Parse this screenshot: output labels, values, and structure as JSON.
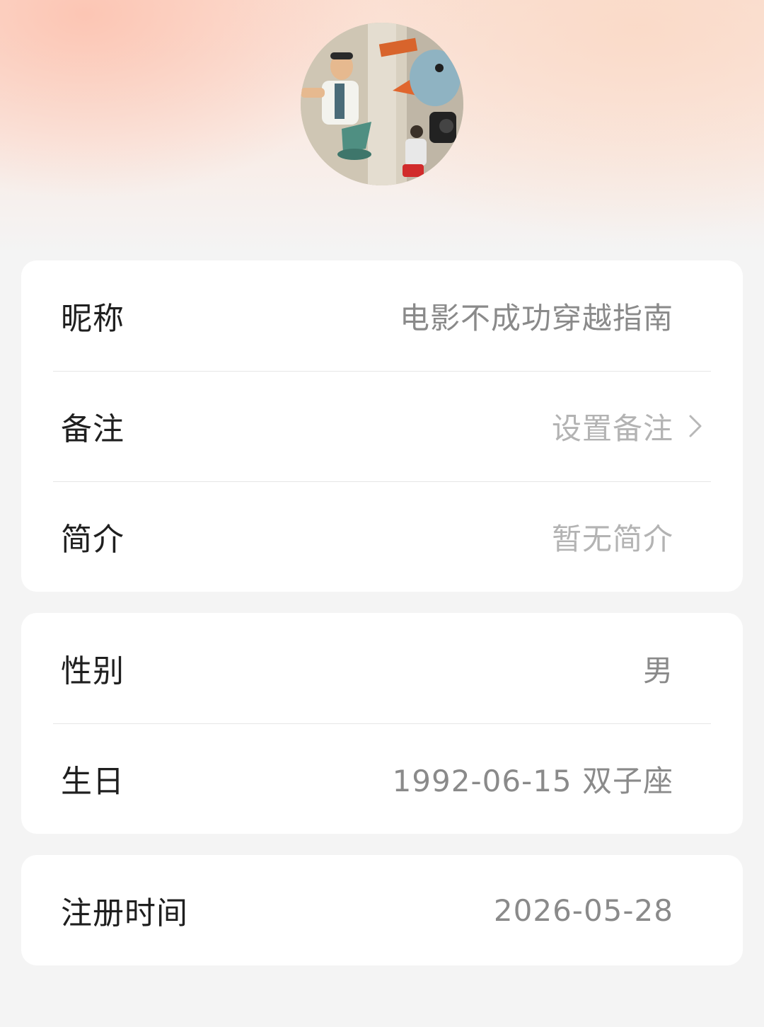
{
  "profile": {
    "avatar_icon": "user-avatar-image"
  },
  "basic_info": {
    "nickname_label": "昵称",
    "nickname_value": "电影不成功穿越指南",
    "remark_label": "备注",
    "remark_value": "设置备注",
    "bio_label": "简介",
    "bio_value": "暂无简介"
  },
  "personal_info": {
    "gender_label": "性别",
    "gender_value": "男",
    "birthday_label": "生日",
    "birthday_value": "1992-06-15 双子座"
  },
  "account_info": {
    "register_label": "注册时间",
    "register_value": "2026-05-28"
  },
  "icons": {
    "chevron": "chevron-right-icon"
  },
  "colors": {
    "header_gradient": "#fbe3d8",
    "page_background": "#f4f4f4",
    "card_background": "#ffffff",
    "value_text": "#8a8a8a",
    "placeholder_text": "#b3b3b3"
  }
}
